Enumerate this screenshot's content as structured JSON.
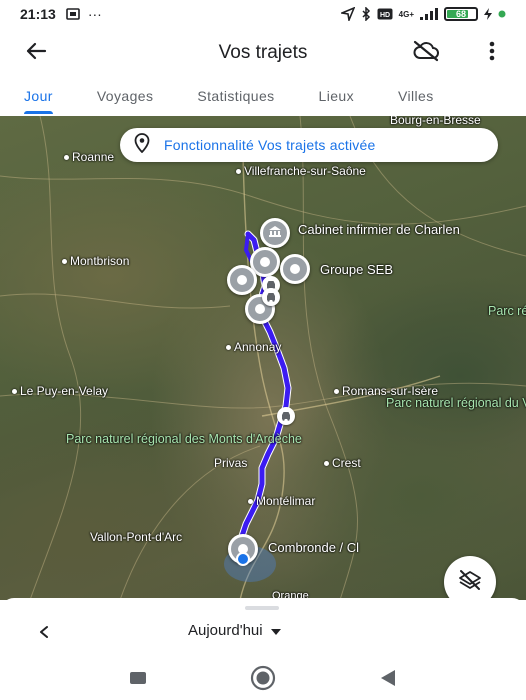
{
  "status_bar": {
    "time": "21:13",
    "more": "···",
    "network": "4G+",
    "battery_level": "68"
  },
  "app_bar": {
    "title": "Vos trajets",
    "back_icon": "arrow-left-icon",
    "location_off_icon": "cloud-off-icon",
    "menu_icon": "more-vertical-icon"
  },
  "tabs": [
    {
      "label": "Jour",
      "active": true
    },
    {
      "label": "Voyages",
      "active": false
    },
    {
      "label": "Statistiques",
      "active": false
    },
    {
      "label": "Lieux",
      "active": false
    },
    {
      "label": "Villes",
      "active": false
    }
  ],
  "map": {
    "banner": "Fonctionnalité Vos trajets activée",
    "places": {
      "bourg": "Bourg-en-Bresse",
      "roanne": "Roanne",
      "villefranche": "Villefranche-sur-Saône",
      "cabinet": "Cabinet infirmier de Charlen",
      "montbrison": "Montbrison",
      "seb": "Groupe SEB",
      "annonay": "Annonay",
      "puy": "Le Puy-en-Velay",
      "romans": "Romans-sur-Isère",
      "vercors": "Parc naturel régional du Vercors",
      "ardeche": "Parc naturel régional des Monts d'Ardèche",
      "privas": "Privas",
      "crest": "Crest",
      "montelimar": "Montélimar",
      "vallon": "Vallon-Pont-d'Arc",
      "combronde": "Combronde / Cl",
      "orange": "Orange",
      "edge": "Parc régional Cha"
    },
    "route_color": "#3b1cf2",
    "accent": "#1a73e8"
  },
  "sheet": {
    "date_label": "Aujourd'hui"
  },
  "nav": {
    "recents_icon": "square-icon",
    "home_icon": "circle-icon",
    "back_icon": "triangle-back-icon"
  }
}
